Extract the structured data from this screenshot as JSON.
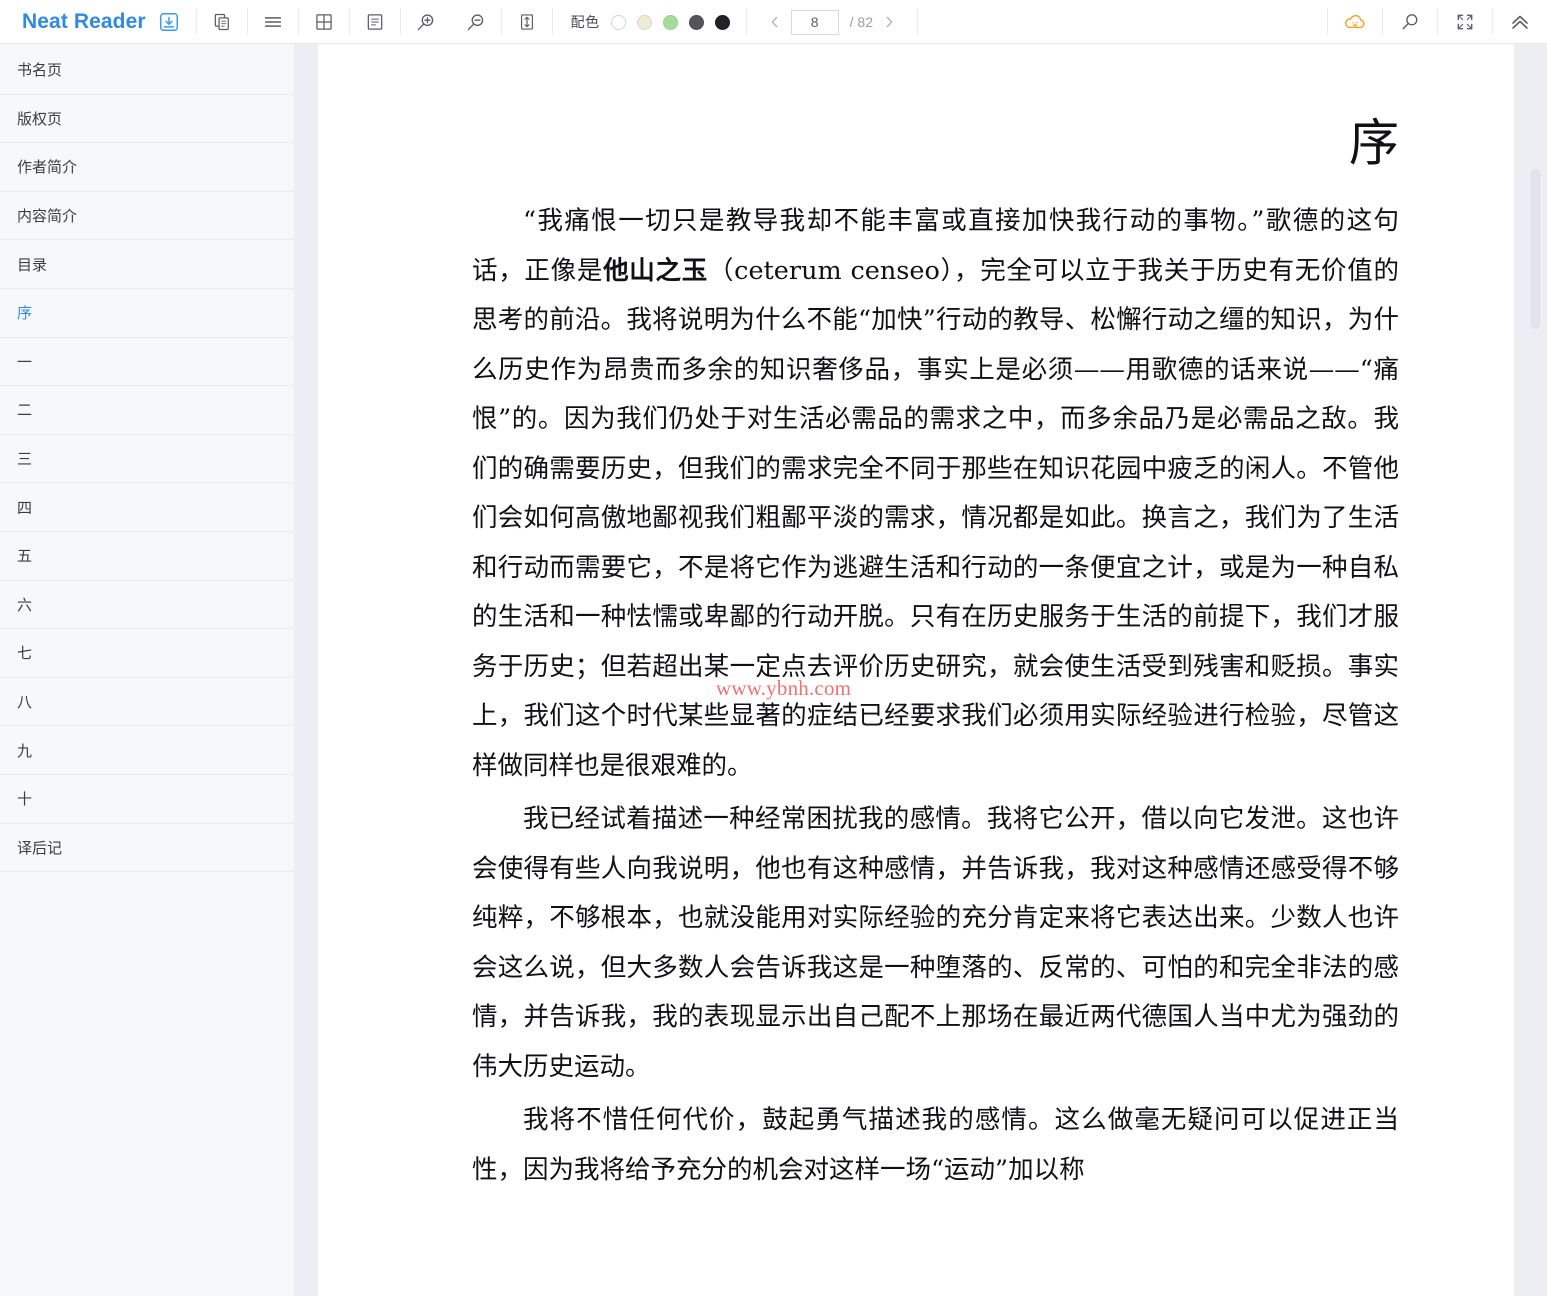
{
  "app": {
    "brand_name": "Neat Reader",
    "brand_icon": "save-download-icon"
  },
  "toolbar": {
    "left_icons": [
      {
        "name": "copy-pages-icon",
        "label": ""
      },
      {
        "name": "hamburger-menu-icon",
        "label": ""
      },
      {
        "name": "grid-layout-icon",
        "label": ""
      },
      {
        "name": "document-text-icon",
        "label": ""
      }
    ],
    "zoom_in_icon": "zoom-in-icon",
    "zoom_out_icon": "zoom-out-icon",
    "line-height_icon": "line-spacing-icon",
    "scheme": {
      "label": "配色",
      "swatches": [
        {
          "name": "white",
          "color": "#ffffff"
        },
        {
          "name": "cream",
          "color": "#efeada"
        },
        {
          "name": "green",
          "color": "#a5dc9c"
        },
        {
          "name": "gray",
          "color": "#555558"
        },
        {
          "name": "black",
          "color": "#232326"
        }
      ]
    },
    "pager": {
      "prev_icon": "chevron-left-icon",
      "next_icon": "chevron-right-icon",
      "current_page": "8",
      "total_label": "/ 82"
    },
    "right_icons": [
      {
        "name": "cloud-sync-icon",
        "color": "#f3a32a"
      },
      {
        "name": "search-icon",
        "color": "#5c5c63"
      },
      {
        "name": "fullscreen-icon",
        "color": "#5c5c63"
      },
      {
        "name": "collapse-up-icon",
        "color": "#5c5c63"
      }
    ]
  },
  "sidebar": {
    "items": [
      {
        "label": "书名页",
        "active": false
      },
      {
        "label": "版权页",
        "active": false
      },
      {
        "label": "作者简介",
        "active": false
      },
      {
        "label": "内容简介",
        "active": false
      },
      {
        "label": "目录",
        "active": false
      },
      {
        "label": "序",
        "active": true
      },
      {
        "label": "一",
        "active": false
      },
      {
        "label": "二",
        "active": false
      },
      {
        "label": "三",
        "active": false
      },
      {
        "label": "四",
        "active": false
      },
      {
        "label": "五",
        "active": false
      },
      {
        "label": "六",
        "active": false
      },
      {
        "label": "七",
        "active": false
      },
      {
        "label": "八",
        "active": false
      },
      {
        "label": "九",
        "active": false
      },
      {
        "label": "十",
        "active": false
      },
      {
        "label": "译后记",
        "active": false
      }
    ]
  },
  "content": {
    "title": "序",
    "paragraph1_a": "“我痛恨一切只是教导我却不能丰富或直接加快我行动的事物。”歌德的这句话，正像是",
    "paragraph1_bold": "他山之玉",
    "paragraph1_b": "（ceterum censeo），完全可以立于我关于历史有无价值的思考的前沿。我将说明为什么不能“加快”行动的教导、松懈行动之缰的知识，为什么历史作为昂贵而多余的知识奢侈品，事实上是必须——用歌德的话来说——“痛恨”的。因为我们仍处于对生活必需品的需求之中，而多余品乃是必需品之敌。我们的确需要历史，但我们的需求完全不同于那些在知识花园中疲乏的闲人。不管他们会如何高傲地鄙视我们粗鄙平淡的需求，情况都是如此。换言之，我们为了生活和行动而需要它，不是将它作为逃避生活和行动的一条便宜之计，或是为一种自私的生活和一种怯懦或卑鄙的行动开脱。只有在历史服务于生活的前提下，我们才服务于历史；但若超出某一定点去评价历史研究，就会使生活受到残害和贬损。事实上，我们这个时代某些显著的症结已经要求我们必须用实际经验进行检验，尽管这样做同样也是很艰难的。",
    "paragraph2": "我已经试着描述一种经常困扰我的感情。我将它公开，借以向它发泄。这也许会使得有些人向我说明，他也有这种感情，并告诉我，我对这种感情还感受得不够纯粹，不够根本，也就没能用对实际经验的充分肯定来将它表达出来。少数人也许会这么说，但大多数人会告诉我这是一种堕落的、反常的、可怕的和完全非法的感情，并告诉我，我的表现显示出自己配不上那场在最近两代德国人当中尤为强劲的伟大历史运动。",
    "paragraph3": "我将不惜任何代价，鼓起勇气描述我的感情。这么做毫无疑问可以促进正当性，因为我将给予充分的机会对这样一场“运动”加以称",
    "watermark": "www.ybnh.com"
  }
}
